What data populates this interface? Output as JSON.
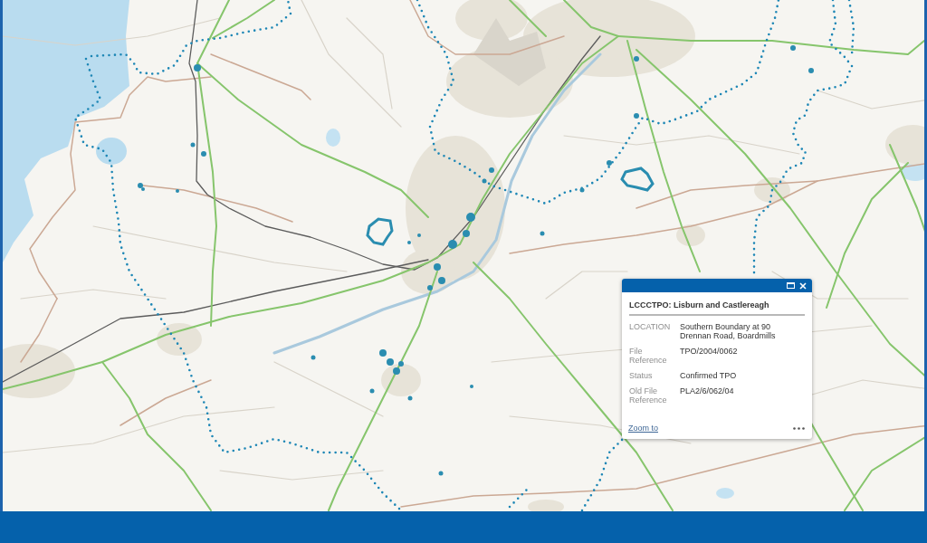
{
  "popup": {
    "title": "LCCCTPO: Lisburn and Castlereagh",
    "fields": [
      {
        "label": "LOCATION",
        "value": "Southern Boundary at 90 Drennan Road, Boardmills"
      },
      {
        "label": "File Reference",
        "value": "TPO/2004/0062"
      },
      {
        "label": "Status",
        "value": "Confirmed TPO"
      },
      {
        "label": "Old File Reference",
        "value": "PLA2/6/062/04"
      }
    ],
    "link": "Zoom to"
  }
}
